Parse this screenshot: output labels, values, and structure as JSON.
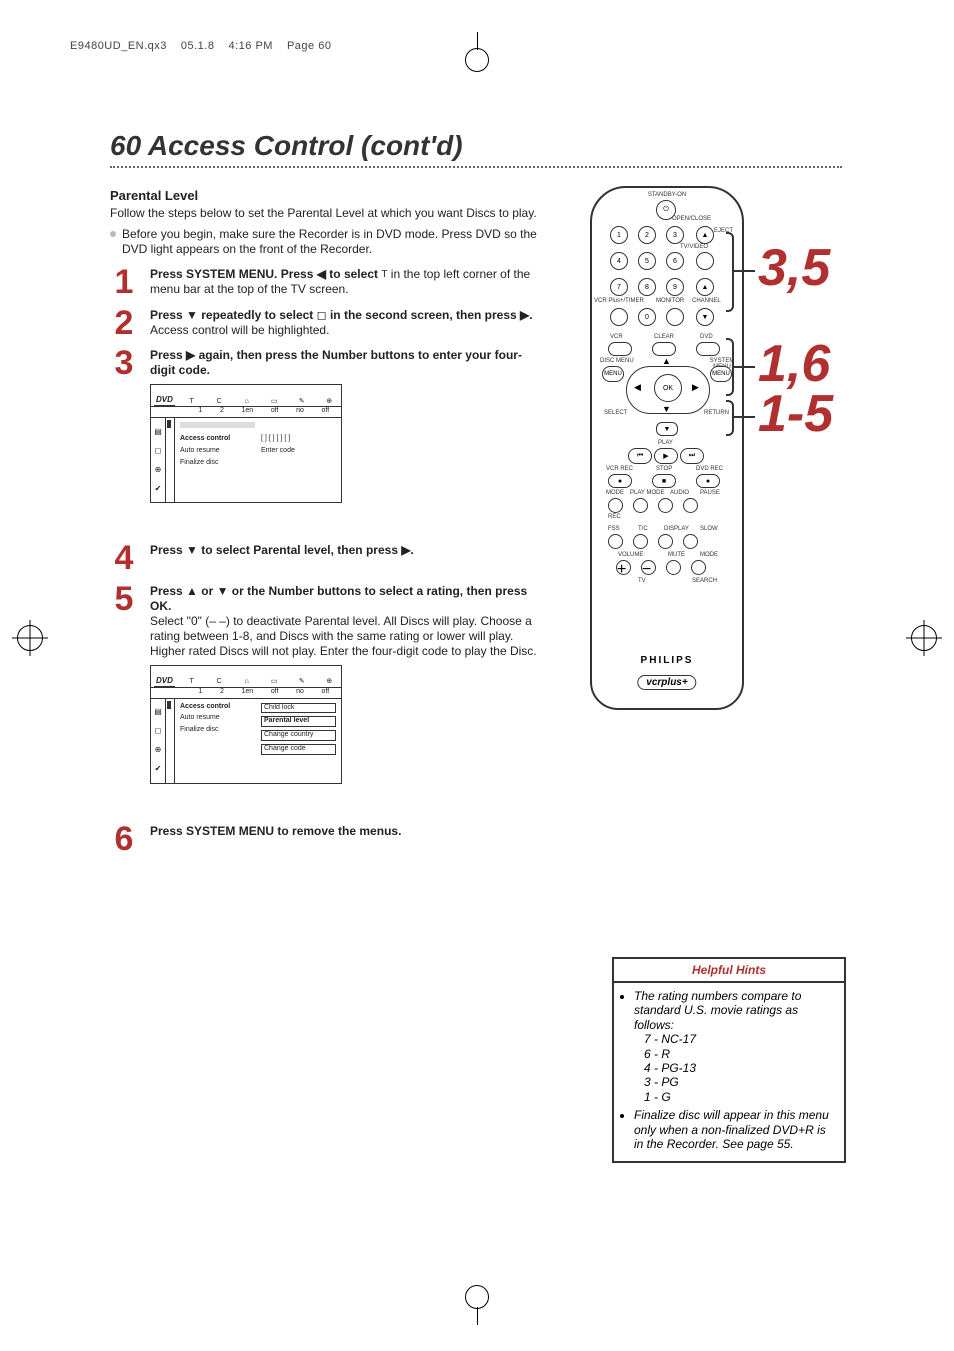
{
  "header": {
    "filename": "E9480UD_EN.qx3",
    "date": "05.1.8",
    "time": "4:16 PM",
    "page_label": "Page 60"
  },
  "title": "60 Access Control (cont'd)",
  "subheading": "Parental Level",
  "intro_text": "Follow the steps below to set the Parental Level at which you want Discs to play.",
  "prebullet": "Before you begin, make sure the Recorder is in DVD mode. Press DVD so the DVD light appears on the front of the Recorder.",
  "steps": {
    "1": {
      "bold": "Press SYSTEM MENU. Press ◀ to select",
      "tail": "in the top left corner of the menu bar at the top of the TV screen."
    },
    "2": {
      "bold_a": "Press ▼ repeatedly to select",
      "bold_b": "in the second screen, then press ▶.",
      "tail": "Access control will be highlighted."
    },
    "3": {
      "bold": "Press ▶ again, then press the Number buttons to enter your four-digit code."
    },
    "4": {
      "bold": "Press ▼ to select Parental level, then press ▶."
    },
    "5": {
      "bold": "Press ▲ or ▼ or the Number buttons to select a rating, then press OK.",
      "tail": "Select \"0\" (– –) to deactivate Parental level.  All Discs will play. Choose a rating between 1-8, and Discs with the same rating or lower will play. Higher rated Discs will not play. Enter the four-digit code to play the Disc."
    },
    "6": {
      "bold": "Press SYSTEM MENU to remove the menus."
    }
  },
  "osd1": {
    "top_icons": [
      "T",
      "C",
      "⌂",
      "▭",
      "✎",
      "⊕"
    ],
    "top_values": [
      "1",
      "2",
      "1en",
      "off",
      "no",
      "off"
    ],
    "dvd": "DVD",
    "side_icons": [
      "▤",
      "◻",
      "⊕",
      "✔"
    ],
    "menu": {
      "items": [
        "Access control",
        "Auto resume",
        "Finalize disc"
      ],
      "selected": "Access control"
    },
    "right": {
      "code_mask": "[ ] [ ] [ ] [ ]",
      "prompt": "Enter code"
    }
  },
  "osd2": {
    "top_icons": [
      "T",
      "C",
      "⌂",
      "▭",
      "✎",
      "⊕"
    ],
    "top_values": [
      "1",
      "2",
      "1en",
      "off",
      "no",
      "off"
    ],
    "dvd": "DVD",
    "side_icons": [
      "▤",
      "◻",
      "⊕",
      "✔"
    ],
    "menu": {
      "items": [
        "Access control",
        "Auto resume",
        "Finalize disc"
      ],
      "selected": "Access control"
    },
    "submenu": {
      "items": [
        "Child lock",
        "Parental level",
        "Change country",
        "Change code"
      ],
      "selected": "Parental level"
    }
  },
  "remote": {
    "labels": {
      "standby": "STANDBY-ON",
      "openclose": "OPEN/CLOSE",
      "eject": "EJECT",
      "tvvideo": "TV/VIDEO",
      "vcrplus": "VCR Plus+/TIMER",
      "monitor": "MONITOR",
      "channel": "CHANNEL",
      "vcr": "VCR",
      "clear": "CLEAR",
      "dvd": "DVD",
      "disc_menu": "DISC MENU",
      "system_menu": "SYSTEM MENU",
      "ok": "OK",
      "select": "SELECT",
      "return": "RETURN",
      "play": "PLAY",
      "vcrrec": "VCR REC",
      "stop": "STOP",
      "dvdrec": "DVD REC",
      "mode": "MODE",
      "playmode": "PLAY MODE",
      "audio": "AUDIO",
      "pause": "PAUSE",
      "rec": "REC",
      "fss": "FSS",
      "tc": "T/C",
      "display": "DISPLAY",
      "slow": "SLOW",
      "volume": "VOLUME",
      "mute": "MUTE",
      "mode2": "MODE",
      "tv": "TV",
      "search": "SEARCH"
    },
    "numbers": [
      "1",
      "2",
      "3",
      "4",
      "5",
      "6",
      "7",
      "8",
      "9",
      "0"
    ],
    "brand": "PHILIPS",
    "model": "vcrplus+"
  },
  "callouts": {
    "c1": "3,5",
    "c2": "1,6",
    "c3": "1-5"
  },
  "hints": {
    "title": "Helpful Hints",
    "item1_intro": "The rating numbers compare to standard U.S. movie ratings as follows:",
    "ratings": [
      "7 - NC-17",
      "6 - R",
      "4 - PG-13",
      "3 - PG",
      "1 - G"
    ],
    "item2": "Finalize disc will appear in this menu only when a non-finalized DVD+R is in the Recorder. See page 55."
  }
}
